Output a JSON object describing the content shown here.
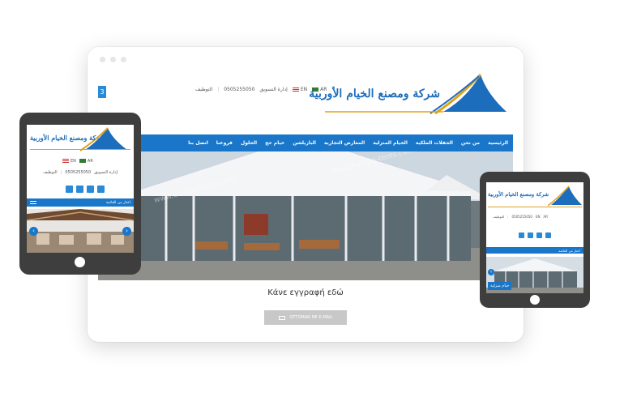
{
  "desktop": {
    "top_bar": {
      "left_tab": "3",
      "jobs": "التوظيف",
      "phone": "0505255050",
      "marketing": "إدارة التسويق",
      "lang_en": "EN",
      "lang_ar": "AR"
    },
    "logo_text": "شركة ومصنع الخيام الأوربية",
    "nav": [
      "الرئيسية",
      "من نحن",
      "الحفلات الملكية",
      "الخيام المنزلية",
      "المعارض التجارية",
      "البازيلشن",
      "خيام حج",
      "الحلول",
      "فروعنا",
      "اتصل بنا"
    ],
    "watermark": "www.europa-tents.com",
    "caption": "Κάνε εγγραφή εδώ",
    "cta_label": "OTTOMAN ME E-MAIL"
  },
  "tablet_left": {
    "logo_text": "شركة ومصنع الخيام الأوربية",
    "lang_en": "EN",
    "lang_ar": "AR",
    "jobs": "التوظيف",
    "phone": "0505255050",
    "marketing": "إدارة التسويق",
    "menu_label": "اختار من القائمة"
  },
  "tablet_right": {
    "logo_text": "شركة ومصنع الخيام الأوربية",
    "jobs": "التوظيف",
    "phone": "0505255050",
    "lang_en": "EN",
    "lang_ar": "AR",
    "menu_label": "اختار من القائمة",
    "slide_label": "خيام منزلية"
  },
  "colors": {
    "brand_blue": "#1976c8",
    "logo_gold": "#e0a21d",
    "device_frame": "#3e3e3e"
  }
}
